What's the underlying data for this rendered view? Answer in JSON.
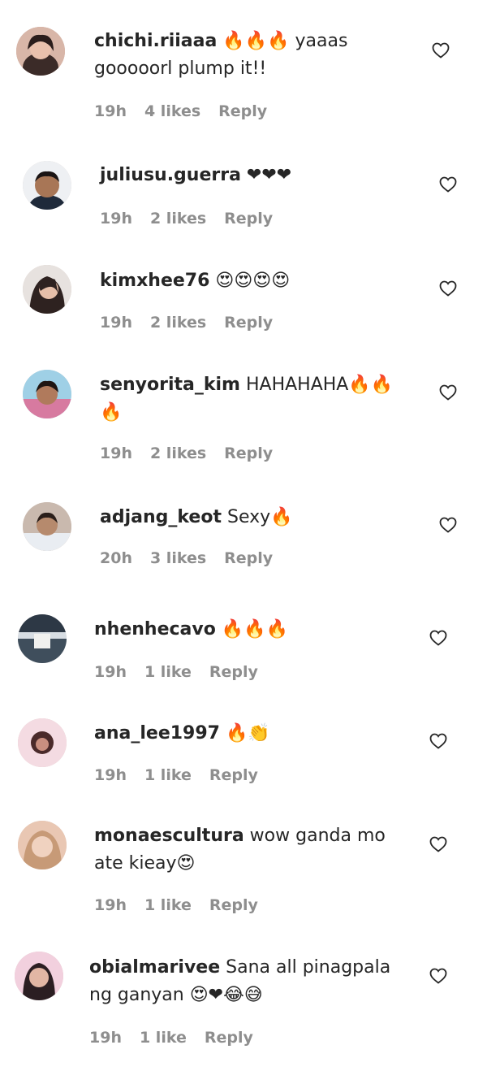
{
  "comments": [
    {
      "user": "chichi.riiaaa",
      "text": " 🔥🔥🔥 yaaas gooooorl plump it!!",
      "time": "19h",
      "likes": "4 likes",
      "reply": "Reply"
    },
    {
      "user": "juliusu.guerra",
      "text": " ❤❤❤",
      "time": "19h",
      "likes": "2 likes",
      "reply": "Reply"
    },
    {
      "user": "kimxhee76",
      "text": " 😍😍😍😍",
      "time": "19h",
      "likes": "2 likes",
      "reply": "Reply"
    },
    {
      "user": "senyorita_kim",
      "text": " HAHAHAHA🔥🔥🔥",
      "time": "19h",
      "likes": "2 likes",
      "reply": "Reply"
    },
    {
      "user": "adjang_keot",
      "text": " Sexy🔥",
      "time": "20h",
      "likes": "3 likes",
      "reply": "Reply"
    },
    {
      "user": "nhenhecavo",
      "text": " 🔥🔥🔥",
      "time": "19h",
      "likes": "1 like",
      "reply": "Reply"
    },
    {
      "user": "ana_lee1997",
      "text": " 🔥👏",
      "time": "19h",
      "likes": "1 like",
      "reply": "Reply"
    },
    {
      "user": "monaescultura",
      "text": " wow ganda mo ate kieay😍",
      "time": "19h",
      "likes": "1 like",
      "reply": "Reply"
    },
    {
      "user": "obialmarivee",
      "text": " Sana all pinagpala ng ganyan 😍❤😂😅",
      "time": "19h",
      "likes": "1 like",
      "reply": "Reply"
    }
  ],
  "colors": {
    "text": "#262626",
    "meta": "#8e8e8e"
  },
  "icons": {
    "like": "heart-outline-icon"
  }
}
